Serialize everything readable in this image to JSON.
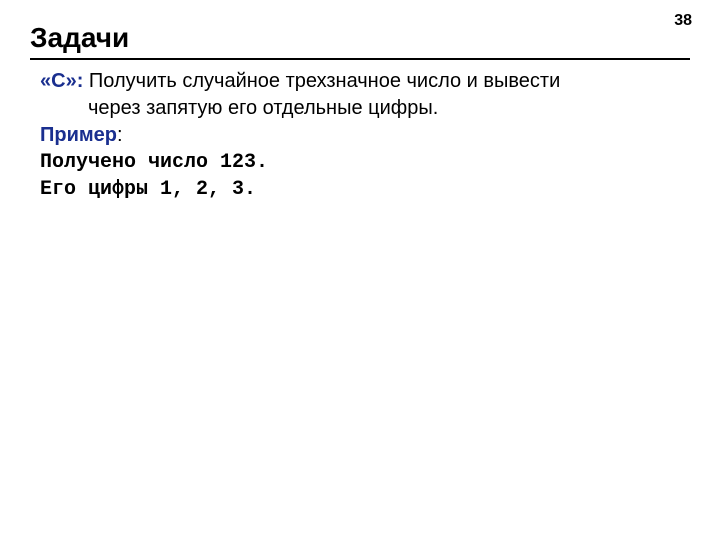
{
  "page_number": "38",
  "title": "Задачи",
  "task": {
    "label": "«С»:",
    "line1": " Получить случайное трехзначное число и вывести",
    "line2": "через запятую его отдельные цифры."
  },
  "example": {
    "label": "Пример",
    "colon": ":",
    "line1": "Получено число 123.",
    "line2": "Его цифры 1, 2, 3."
  }
}
